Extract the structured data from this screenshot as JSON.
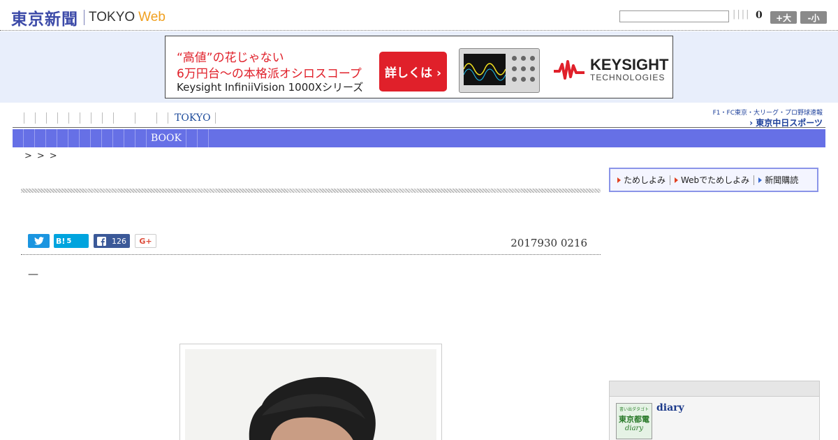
{
  "header": {
    "logo_jp": "東京新聞",
    "logo_en": "TOKYO",
    "logo_web": "Web",
    "search": {
      "value": "",
      "placeholder": ""
    },
    "separators": "||||",
    "font_count": "0",
    "font_plus": "+大",
    "font_minus": "-小"
  },
  "ad": {
    "line1": "“高値”の花じゃない",
    "line2": "6万円台～の本格派オシロスコープ",
    "line3": "Keysight InfiniiVision 1000Xシリーズ",
    "cta": "詳しくは ›",
    "brand": "KEYSIGHT",
    "brand_sub": "TECHNOLOGIES",
    "colors": {
      "accent": "#e0202a"
    }
  },
  "subnav": {
    "item": "TOKYO",
    "chunichi_top": "F1・FC東京・大リーグ・プロ野球速報",
    "chunichi_bottom": "› 東京中日スポーツ"
  },
  "navbar": {
    "book": "BOOK",
    "color": "#6670e6"
  },
  "breadcrumb": ">>>",
  "article": {
    "social": {
      "hatena": "B!",
      "hatena_count": "5",
      "facebook_count": "126",
      "googleplus": "G+"
    },
    "date": "2017930 0216",
    "dash": "—"
  },
  "sidebar": {
    "tameshi": [
      "ためしよみ",
      "Webでためしよみ",
      "新聞購読"
    ],
    "diary": {
      "logo_small": "書い出ダタゴト",
      "logo_main": "東京都電",
      "logo_sub": "diary",
      "title": "diary"
    }
  }
}
